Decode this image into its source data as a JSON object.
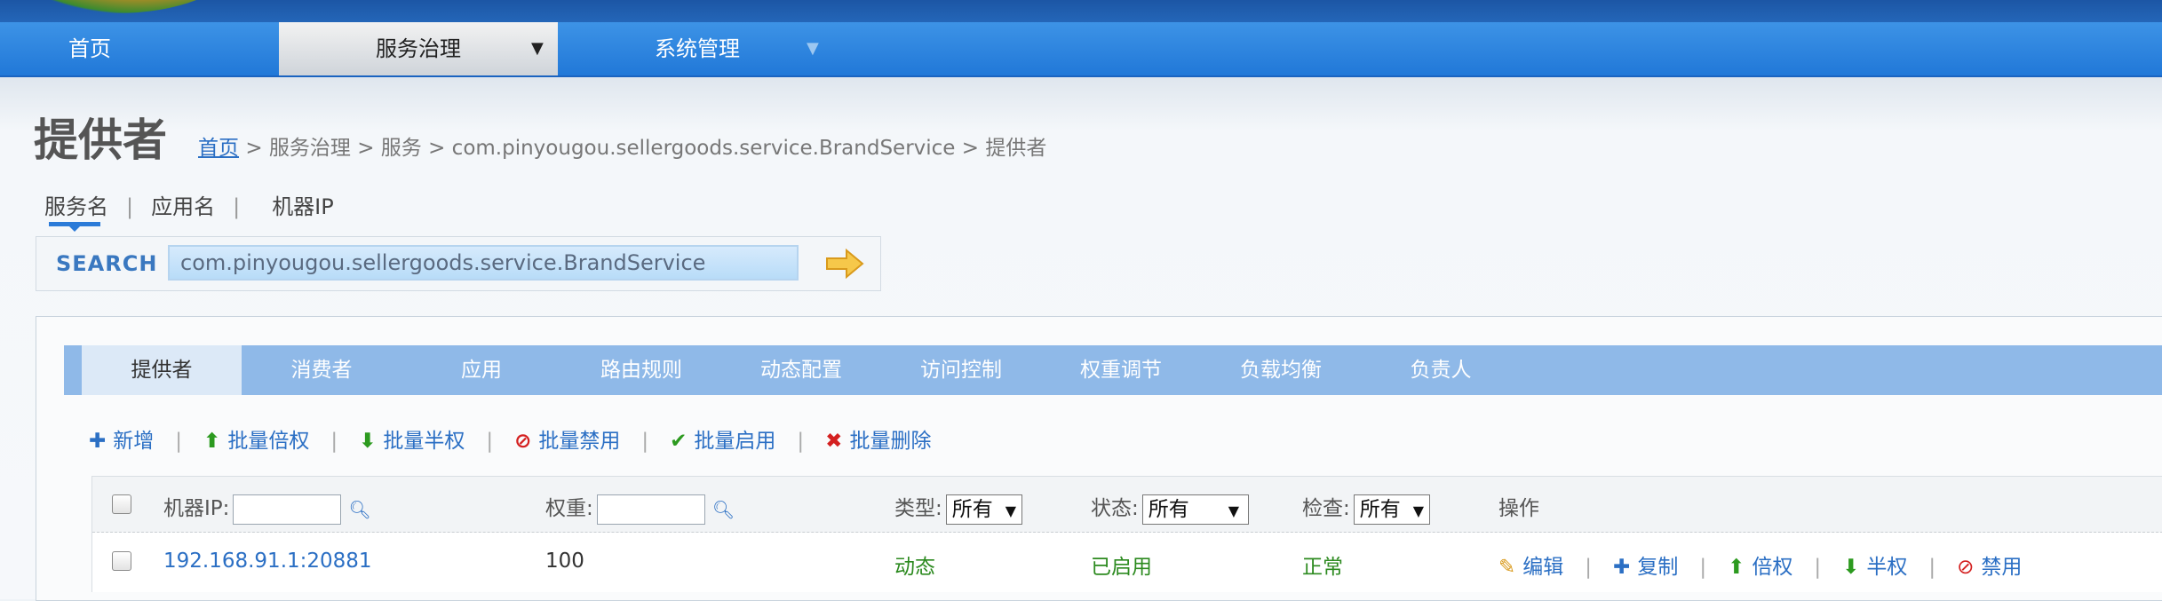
{
  "colors": {
    "accent": "#2b7bd8",
    "link": "#2b6fc4",
    "status_green": "#2c8a1f",
    "delete_red": "#d42020"
  },
  "nav": {
    "items": [
      {
        "label": "首页"
      },
      {
        "label": "服务治理",
        "caret": "▼"
      },
      {
        "label": "系统管理",
        "caret": "▼"
      }
    ]
  },
  "page": {
    "title": "提供者",
    "breadcrumb": {
      "home": "首页",
      "rest": "> 服务治理 > 服务 > com.pinyougou.sellergoods.service.BrandService > 提供者"
    }
  },
  "search_tabs": [
    "服务名",
    "应用名",
    "机器IP"
  ],
  "search": {
    "label": "SEARCH",
    "value": "com.pinyougou.sellergoods.service.BrandService",
    "go_icon": "arrow-right-icon"
  },
  "subtabs": [
    "提供者",
    "消费者",
    "应用",
    "路由规则",
    "动态配置",
    "访问控制",
    "权重调节",
    "负载均衡",
    "负责人"
  ],
  "actions": [
    {
      "icon": "plus-icon",
      "glyph": "✚",
      "label": "新增"
    },
    {
      "icon": "arrow-up-icon",
      "glyph": "⬆",
      "label": "批量倍权"
    },
    {
      "icon": "arrow-down-icon",
      "glyph": "⬇",
      "label": "批量半权"
    },
    {
      "icon": "ban-icon",
      "glyph": "⊘",
      "label": "批量禁用"
    },
    {
      "icon": "check-icon",
      "glyph": "✔",
      "label": "批量启用"
    },
    {
      "icon": "x-icon",
      "glyph": "✖",
      "label": "批量删除"
    }
  ],
  "table": {
    "headers": {
      "ip": "机器IP:",
      "weight": "权重:",
      "type": "类型:",
      "status": "状态:",
      "check": "检查:",
      "ops": "操作"
    },
    "filters": {
      "type": "所有",
      "status": "所有",
      "check": "所有",
      "dropdown_glyph": "▼"
    },
    "rows": [
      {
        "ip": "192.168.91.1:20881",
        "weight": "100",
        "type": "动态",
        "status": "已启用",
        "check": "正常",
        "ops": [
          {
            "icon": "pencil-icon",
            "glyph": "✎",
            "label": "编辑"
          },
          {
            "icon": "plus-icon",
            "glyph": "✚",
            "label": "复制"
          },
          {
            "icon": "arrow-up-icon",
            "glyph": "⬆",
            "label": "倍权"
          },
          {
            "icon": "arrow-down-icon",
            "glyph": "⬇",
            "label": "半权"
          },
          {
            "icon": "ban-icon",
            "glyph": "⊘",
            "label": "禁用"
          }
        ]
      }
    ]
  }
}
